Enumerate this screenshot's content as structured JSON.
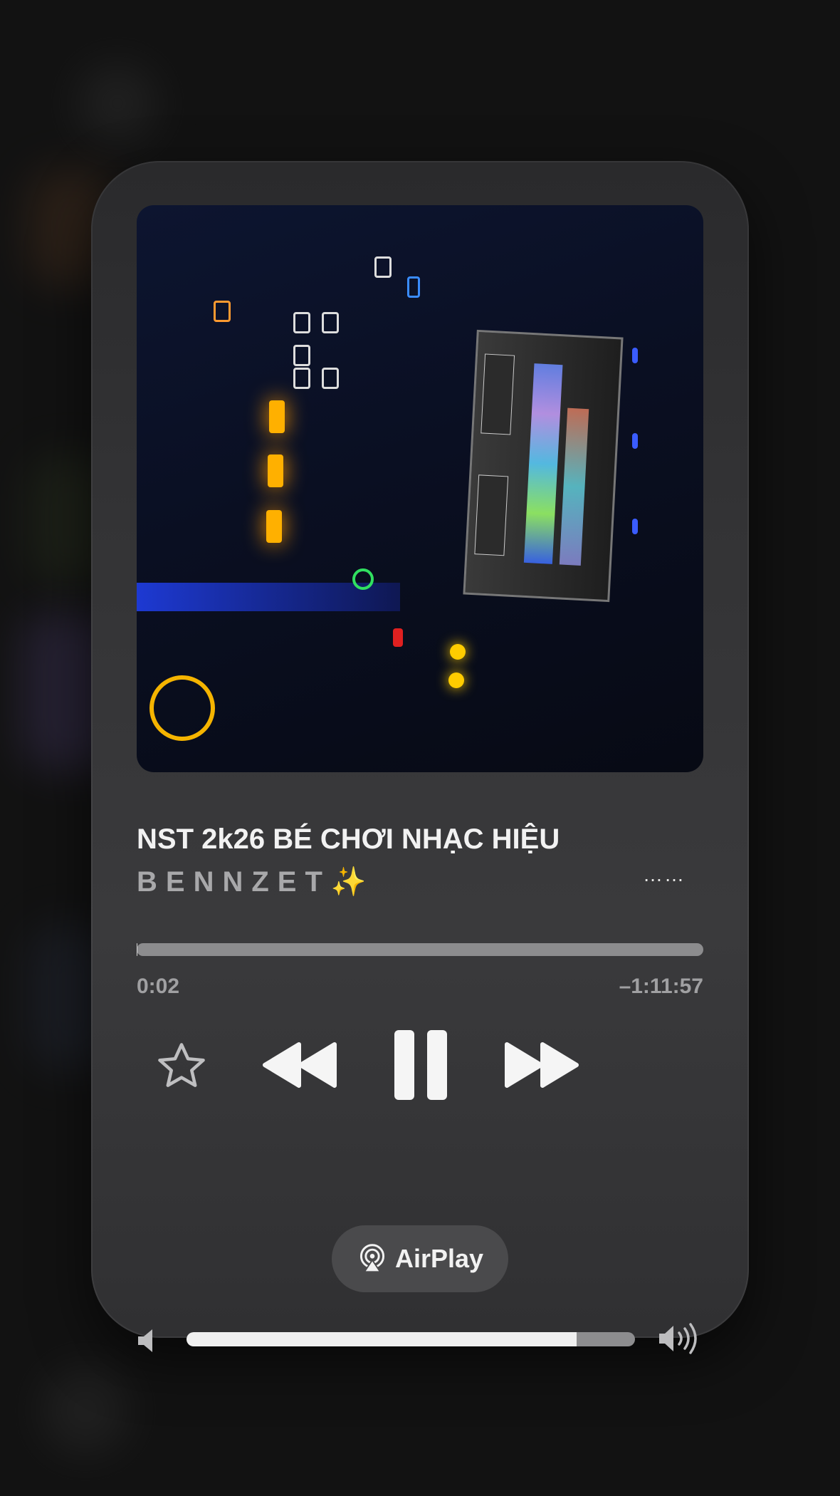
{
  "now_playing": {
    "title": "NST 2k26 BÉ CHƠI NHẠC HIỆU",
    "artist": "BENNZET",
    "artist_emoji": "✨",
    "more_label": "……",
    "elapsed": "0:02",
    "remaining": "–1:11:57",
    "progress_fraction": 0.0005,
    "volume_fraction": 0.87
  },
  "controls": {
    "favorite_icon": "star-icon",
    "previous_icon": "backward-icon",
    "play_pause_icon": "pause-icon",
    "next_icon": "forward-icon"
  },
  "airplay": {
    "label": "AirPlay",
    "icon": "airplay-icon"
  },
  "colors": {
    "card_background": "#333335",
    "text_primary": "#f2f2f2",
    "text_secondary": "#a0a0a2"
  }
}
